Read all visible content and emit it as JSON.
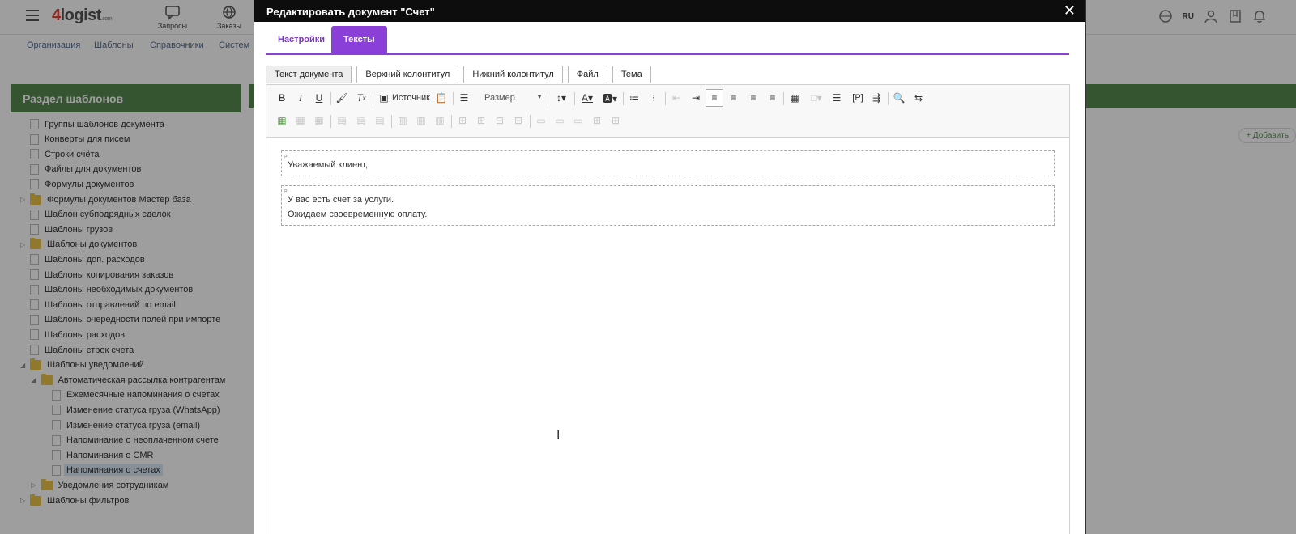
{
  "app": {
    "logo": {
      "prefix": "4",
      "name": "logist",
      "suffix": ".com"
    },
    "topnav": [
      {
        "label": "Запросы",
        "icon": "chat-icon"
      },
      {
        "label": "Заказы",
        "icon": "globe-icon"
      }
    ],
    "language": "RU",
    "subnav": [
      "Организация",
      "Шаблоны",
      "Справочники",
      "Систем"
    ],
    "left_panel": {
      "title": "Раздел шаблонов",
      "tree": [
        {
          "label": "Группы шаблонов документа",
          "type": "doc",
          "level": 0
        },
        {
          "label": "Конверты для писем",
          "type": "doc",
          "level": 0
        },
        {
          "label": "Строки счёта",
          "type": "doc",
          "level": 0
        },
        {
          "label": "Файлы для документов",
          "type": "doc",
          "level": 0
        },
        {
          "label": "Формулы документов",
          "type": "doc",
          "level": 0
        },
        {
          "label": "Формулы документов Мастер база",
          "type": "folder",
          "level": 0,
          "toggle": "▷"
        },
        {
          "label": "Шаблон субподрядных сделок",
          "type": "doc",
          "level": 0
        },
        {
          "label": "Шаблоны грузов",
          "type": "doc",
          "level": 0
        },
        {
          "label": "Шаблоны документов",
          "type": "folder",
          "level": 0,
          "toggle": "▷"
        },
        {
          "label": "Шаблоны доп. расходов",
          "type": "doc",
          "level": 0
        },
        {
          "label": "Шаблоны копирования заказов",
          "type": "doc",
          "level": 0
        },
        {
          "label": "Шаблоны необходимых документов",
          "type": "doc",
          "level": 0
        },
        {
          "label": "Шаблоны отправлений по email",
          "type": "doc",
          "level": 0
        },
        {
          "label": "Шаблоны очередности полей при импорте",
          "type": "doc",
          "level": 0
        },
        {
          "label": "Шаблоны расходов",
          "type": "doc",
          "level": 0
        },
        {
          "label": "Шаблоны строк счета",
          "type": "doc",
          "level": 0
        },
        {
          "label": "Шаблоны уведомлений",
          "type": "folder",
          "level": 0,
          "toggle": "◢"
        },
        {
          "label": "Автоматическая рассылка контрагентам",
          "type": "folder",
          "level": 1,
          "toggle": "◢"
        },
        {
          "label": "Ежемесячные напоминания о счетах",
          "type": "doc",
          "level": 2
        },
        {
          "label": "Изменение статуса груза (WhatsApp)",
          "type": "doc",
          "level": 2
        },
        {
          "label": "Изменение статуса груза (email)",
          "type": "doc",
          "level": 2
        },
        {
          "label": "Напоминание о неоплаченном счете",
          "type": "doc",
          "level": 2
        },
        {
          "label": "Напоминания о CMR",
          "type": "doc",
          "level": 2
        },
        {
          "label": "Напоминания о счетах",
          "type": "doc",
          "level": 2,
          "selected": true
        },
        {
          "label": "Уведомления сотрудникам",
          "type": "folder",
          "level": 1,
          "toggle": "▷"
        },
        {
          "label": "Шаблоны фильтров",
          "type": "folder",
          "level": 0,
          "toggle": "▷"
        }
      ]
    },
    "add_button": "+ Добавить"
  },
  "modal": {
    "title": "Редактировать документ \"Счет\"",
    "close": "✕",
    "tabs": [
      {
        "label": "Настройки",
        "active": false
      },
      {
        "label": "Тексты",
        "active": true
      }
    ],
    "subtabs": [
      {
        "label": "Текст документа",
        "active": true
      },
      {
        "label": "Верхний колонтитул",
        "active": false
      },
      {
        "label": "Нижний колонтитул",
        "active": false
      },
      {
        "label": "Файл",
        "active": false
      },
      {
        "label": "Тема",
        "active": false
      }
    ],
    "toolbar": {
      "source_label": "Источник",
      "size_label": "Размер",
      "paragraph_tag": "[P]"
    },
    "content": {
      "paragraph_marker": "P",
      "paragraphs": [
        [
          "Уважаемый клиент,"
        ],
        [
          "У вас есть счет за услуги.",
          "Ожидаем своевременную оплату."
        ]
      ]
    }
  },
  "colors": {
    "accent": "#8a3fd9",
    "panel_green": "#548a4d",
    "title_bar": "#0d0d0d"
  }
}
